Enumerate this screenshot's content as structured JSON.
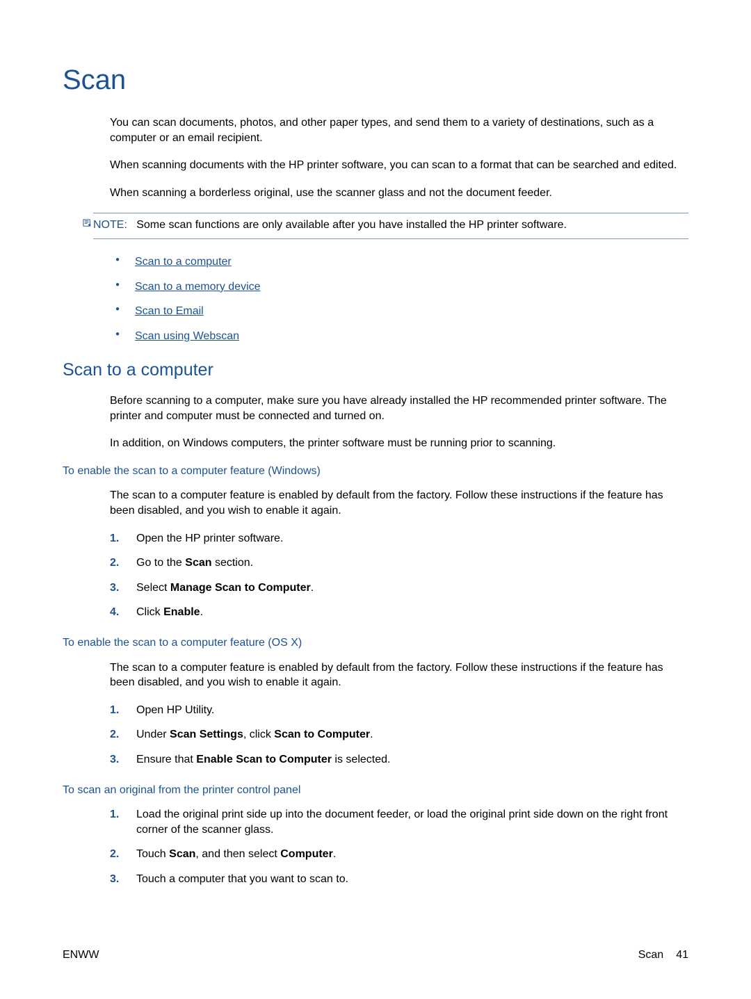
{
  "title": "Scan",
  "intro": {
    "p1": "You can scan documents, photos, and other paper types, and send them to a variety of destinations, such as a computer or an email recipient.",
    "p2": "When scanning documents with the HP printer software, you can scan to a format that can be searched and edited.",
    "p3": "When scanning a borderless original, use the scanner glass and not the document feeder."
  },
  "note": {
    "label": "NOTE:",
    "text": "Some scan functions are only available after you have installed the HP printer software."
  },
  "links": {
    "l1": "Scan to a computer",
    "l2": "Scan to a memory device",
    "l3": "Scan to Email",
    "l4": "Scan using Webscan"
  },
  "section1": {
    "heading": "Scan to a computer",
    "p1": "Before scanning to a computer, make sure you have already installed the HP recommended printer software. The printer and computer must be connected and turned on.",
    "p2": "In addition, on Windows computers, the printer software must be running prior to scanning."
  },
  "sub1": {
    "heading": "To enable the scan to a computer feature (Windows)",
    "p1": "The scan to a computer feature is enabled by default from the factory. Follow these instructions if the feature has been disabled, and you wish to enable it again.",
    "steps": {
      "n1": "1.",
      "s1": "Open the HP printer software.",
      "n2": "2.",
      "s2a": "Go to the ",
      "s2b": "Scan",
      "s2c": " section.",
      "n3": "3.",
      "s3a": "Select ",
      "s3b": "Manage Scan to Computer",
      "s3c": ".",
      "n4": "4.",
      "s4a": "Click ",
      "s4b": "Enable",
      "s4c": "."
    }
  },
  "sub2": {
    "heading": "To enable the scan to a computer feature (OS X)",
    "p1": "The scan to a computer feature is enabled by default from the factory. Follow these instructions if the feature has been disabled, and you wish to enable it again.",
    "steps": {
      "n1": "1.",
      "s1": "Open HP Utility.",
      "n2": "2.",
      "s2a": "Under ",
      "s2b": "Scan Settings",
      "s2c": ", click ",
      "s2d": "Scan to Computer",
      "s2e": ".",
      "n3": "3.",
      "s3a": "Ensure that ",
      "s3b": "Enable Scan to Computer",
      "s3c": " is selected."
    }
  },
  "sub3": {
    "heading": "To scan an original from the printer control panel",
    "steps": {
      "n1": "1.",
      "s1": "Load the original print side up into the document feeder, or load the original print side down on the right front corner of the scanner glass.",
      "n2": "2.",
      "s2a": "Touch ",
      "s2b": "Scan",
      "s2c": ", and then select ",
      "s2d": "Computer",
      "s2e": ".",
      "n3": "3.",
      "s3": "Touch a computer that you want to scan to."
    }
  },
  "footer": {
    "left": "ENWW",
    "right_label": "Scan",
    "right_page": "41"
  }
}
